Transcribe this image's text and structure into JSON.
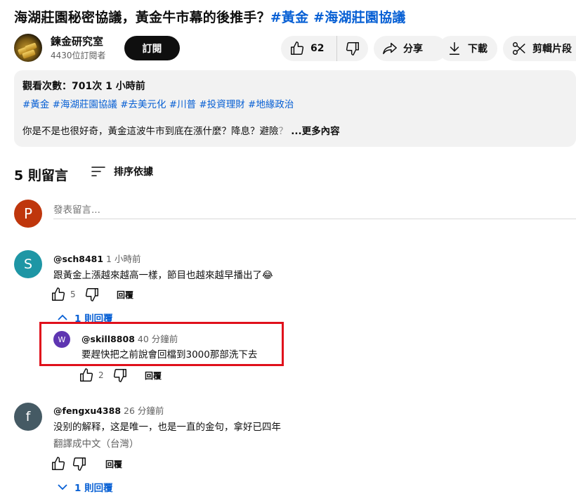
{
  "video": {
    "title_main": "海湖莊園秘密協議，黃金牛市幕的後推手？",
    "title_tags": "#黃金 #海湖莊園協議"
  },
  "channel": {
    "name": "鍊金研究室",
    "subscribers": "4430位訂閱者",
    "subscribe_label": "訂閱"
  },
  "actions": {
    "like_count": "62",
    "share_label": "分享",
    "download_label": "下載",
    "clip_label": "剪輯片段"
  },
  "description": {
    "meta": "觀看次數：701次  1 小時前",
    "tags": "#黃金 #海湖莊園協議 #去美元化 #川普 #投資理財 #地緣政治",
    "text": "你是不是也很好奇，黃金這波牛市到底在漲什麼？降息？避險",
    "dim_text": "？",
    "more_label": "...更多內容"
  },
  "comments": {
    "count_label": "5 則留言",
    "sort_label": "排序依據",
    "add_placeholder": "發表留言...",
    "current_user_initial": "P",
    "items": [
      {
        "initial": "S",
        "author": "@sch8481",
        "time": "1 小時前",
        "text": "跟黃金上漲越來越高一樣，節目也越來越早播出了😂",
        "likes": "5",
        "reply_label": "回覆",
        "replies_label": "1 則回覆",
        "color": "#1e96a5"
      },
      {
        "initial": "W",
        "author": "@skill8808",
        "time": "40 分鐘前",
        "text": "要趕快把之前說會回檔到3000那部洗下去",
        "likes": "2",
        "reply_label": "回覆",
        "color": "#5e35b1"
      },
      {
        "initial": "f",
        "author": "@fengxu4388",
        "time": "26 分鐘前",
        "text": "没别的解释，这是唯一，也是一直的金句，拿好已四年",
        "translate_label": "翻譯成中文（台灣）",
        "likes": "",
        "reply_label": "回覆",
        "replies_label": "1 則回覆",
        "color": "#455a64"
      }
    ]
  },
  "highlight_color": "#e0101b"
}
